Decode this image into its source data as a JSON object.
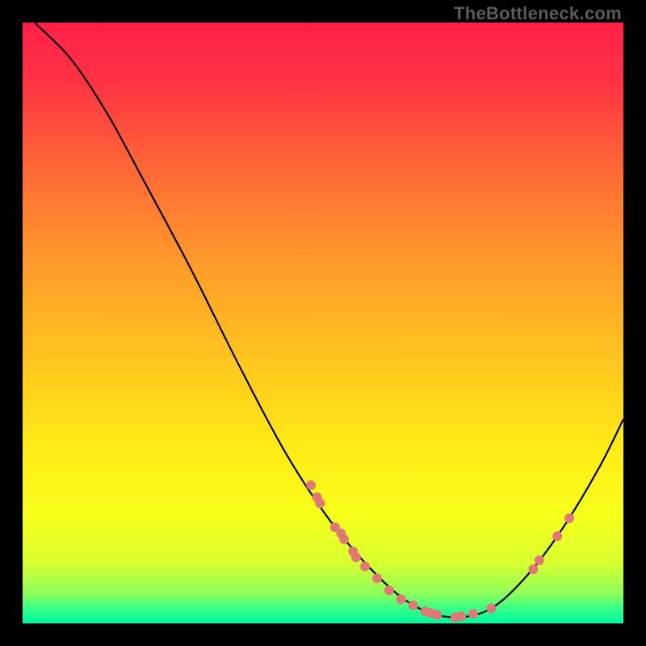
{
  "watermark": "TheBottleneck.com",
  "chart_data": {
    "type": "line",
    "title": "",
    "xlabel": "",
    "ylabel": "",
    "xlim": [
      0,
      100
    ],
    "ylim": [
      0,
      100
    ],
    "grid": false,
    "series": [
      {
        "name": "curve",
        "color": "#000000",
        "points": [
          {
            "x": 2,
            "y": 100
          },
          {
            "x": 8,
            "y": 94
          },
          {
            "x": 14,
            "y": 85
          },
          {
            "x": 20,
            "y": 74
          },
          {
            "x": 28,
            "y": 59
          },
          {
            "x": 36,
            "y": 43
          },
          {
            "x": 44,
            "y": 28
          },
          {
            "x": 52,
            "y": 16
          },
          {
            "x": 60,
            "y": 7
          },
          {
            "x": 66,
            "y": 2.5
          },
          {
            "x": 72,
            "y": 1
          },
          {
            "x": 78,
            "y": 2.5
          },
          {
            "x": 84,
            "y": 8
          },
          {
            "x": 90,
            "y": 16
          },
          {
            "x": 96,
            "y": 26
          },
          {
            "x": 100,
            "y": 34
          }
        ]
      }
    ],
    "scatter": {
      "name": "markers",
      "color": "#e07878",
      "radius": 6,
      "points": [
        {
          "x": 48,
          "y": 23
        },
        {
          "x": 49,
          "y": 21
        },
        {
          "x": 49.5,
          "y": 20
        },
        {
          "x": 52,
          "y": 16
        },
        {
          "x": 53,
          "y": 15
        },
        {
          "x": 53.5,
          "y": 14
        },
        {
          "x": 55,
          "y": 12
        },
        {
          "x": 55.5,
          "y": 11
        },
        {
          "x": 57,
          "y": 9.5
        },
        {
          "x": 59,
          "y": 7.5
        },
        {
          "x": 61,
          "y": 5.5
        },
        {
          "x": 63,
          "y": 4
        },
        {
          "x": 65,
          "y": 3
        },
        {
          "x": 67,
          "y": 2
        },
        {
          "x": 68,
          "y": 1.7
        },
        {
          "x": 69,
          "y": 1.4
        },
        {
          "x": 72,
          "y": 1
        },
        {
          "x": 73,
          "y": 1.2
        },
        {
          "x": 75,
          "y": 1.6
        },
        {
          "x": 78,
          "y": 2.5
        },
        {
          "x": 85,
          "y": 9
        },
        {
          "x": 86,
          "y": 10.5
        },
        {
          "x": 89,
          "y": 14.5
        },
        {
          "x": 91,
          "y": 17.5
        }
      ]
    },
    "gradient_stops": [
      {
        "pos": 0.0,
        "color": "#ff2049"
      },
      {
        "pos": 0.1,
        "color": "#ff3344"
      },
      {
        "pos": 0.25,
        "color": "#ff6a36"
      },
      {
        "pos": 0.4,
        "color": "#ff9a2a"
      },
      {
        "pos": 0.55,
        "color": "#ffc21e"
      },
      {
        "pos": 0.7,
        "color": "#ffe916"
      },
      {
        "pos": 0.82,
        "color": "#f6ff1a"
      },
      {
        "pos": 0.9,
        "color": "#d8ff30"
      },
      {
        "pos": 0.95,
        "color": "#8eff5a"
      },
      {
        "pos": 0.98,
        "color": "#28ff8e"
      },
      {
        "pos": 1.0,
        "color": "#00f7a0"
      }
    ]
  }
}
